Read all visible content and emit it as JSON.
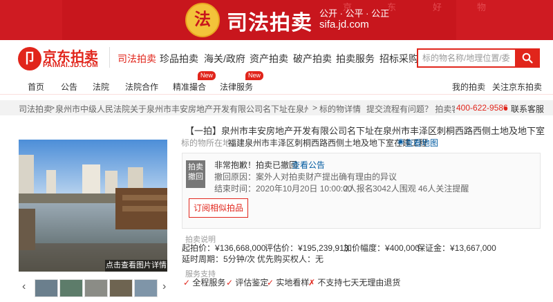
{
  "banner": {
    "emblem_glyph": "法",
    "title": "司法拍卖",
    "slogan": "公开 · 公平 · 公正",
    "domain": "sifa.jd.com",
    "ghost_text": [
      "京",
      "东",
      "好",
      "物"
    ]
  },
  "header": {
    "logo_glyph": "卩",
    "logo_text": "京东拍卖",
    "logo_sub": "PAIMAI.JD.COM",
    "nav": [
      "司法拍卖",
      "珍品拍卖",
      "海关/政府",
      "资产拍卖",
      "破产拍卖",
      "拍卖服务",
      "招标采购"
    ],
    "active_nav": 0,
    "search_placeholder": "标的物名称/地理位置/委",
    "search_icon": "search-icon"
  },
  "subnav": {
    "items": [
      "首页",
      "公告",
      "法院",
      "法院合作",
      "精准撮合",
      "法律服务"
    ],
    "new_badge": "New",
    "right": [
      "我的拍卖",
      "关注京东拍卖"
    ]
  },
  "breadcrumb": {
    "items": [
      "司法拍卖",
      "泉州市中级人民法院关于泉州市丰安房地产开发有限公司名下址在泉州市丰泽区刺",
      "标的物详情"
    ],
    "sep": ">",
    "help": "提交流程有问题？ 拍卖客服热线：",
    "hotline": "400-622-9586",
    "contact": "联系客服"
  },
  "gallery": {
    "view_all_label": "点击查看图片详情",
    "prev_icon": "‹",
    "next_icon": "›",
    "thumb_count": 5
  },
  "lot": {
    "tag": "【一拍】",
    "title": "泉州市丰安房地产开发有限公司名下址在泉州市丰泽区刺桐西路西侧土地及地下室在建工程",
    "location_label": "标的物所在地：",
    "location": "福建泉州市丰泽区刺桐西路西侧土地及地下室在建工程",
    "map_link": "查看地图",
    "status_badge": [
      "拍卖",
      "撤回"
    ],
    "status_notice": "非常抱歉！拍卖已撤回",
    "view_notice": "查看公告",
    "withdraw_reason": "撤回原因：案外人对拍卖财产提出确有理由的异议",
    "end_time": "结束时间：2020年10月20日 10:00:00",
    "signups": "2人报名",
    "watchers": "3042人围观",
    "reminders": "46人关注提醒",
    "follow_button": "订阅相似拍品"
  },
  "auction_info": {
    "heading": "拍卖说明",
    "start_price_label": "起拍价：",
    "start_price": "¥136,668,000",
    "appraisal_label": "评估价：",
    "appraisal": "¥195,239,913",
    "increment_label": "加价幅度：",
    "increment": "¥400,000",
    "deposit_label": "保证金：",
    "deposit": "¥13,667,000",
    "extension_label": "延时周期：",
    "extension": "5分钟/次",
    "priority_label": "优先购买权人：",
    "priority": "无"
  },
  "service": {
    "heading": "服务支持",
    "items": [
      {
        "mark": "✓",
        "text": "全程服务"
      },
      {
        "mark": "✓",
        "text": "评估鉴定"
      },
      {
        "mark": "✓",
        "text": "实地看样"
      },
      {
        "mark": "✗",
        "text": "不支持七天无理由退货"
      }
    ]
  },
  "colors": {
    "brand": "#e1251b",
    "banner": "#c8161d",
    "link": "#005aa0"
  }
}
